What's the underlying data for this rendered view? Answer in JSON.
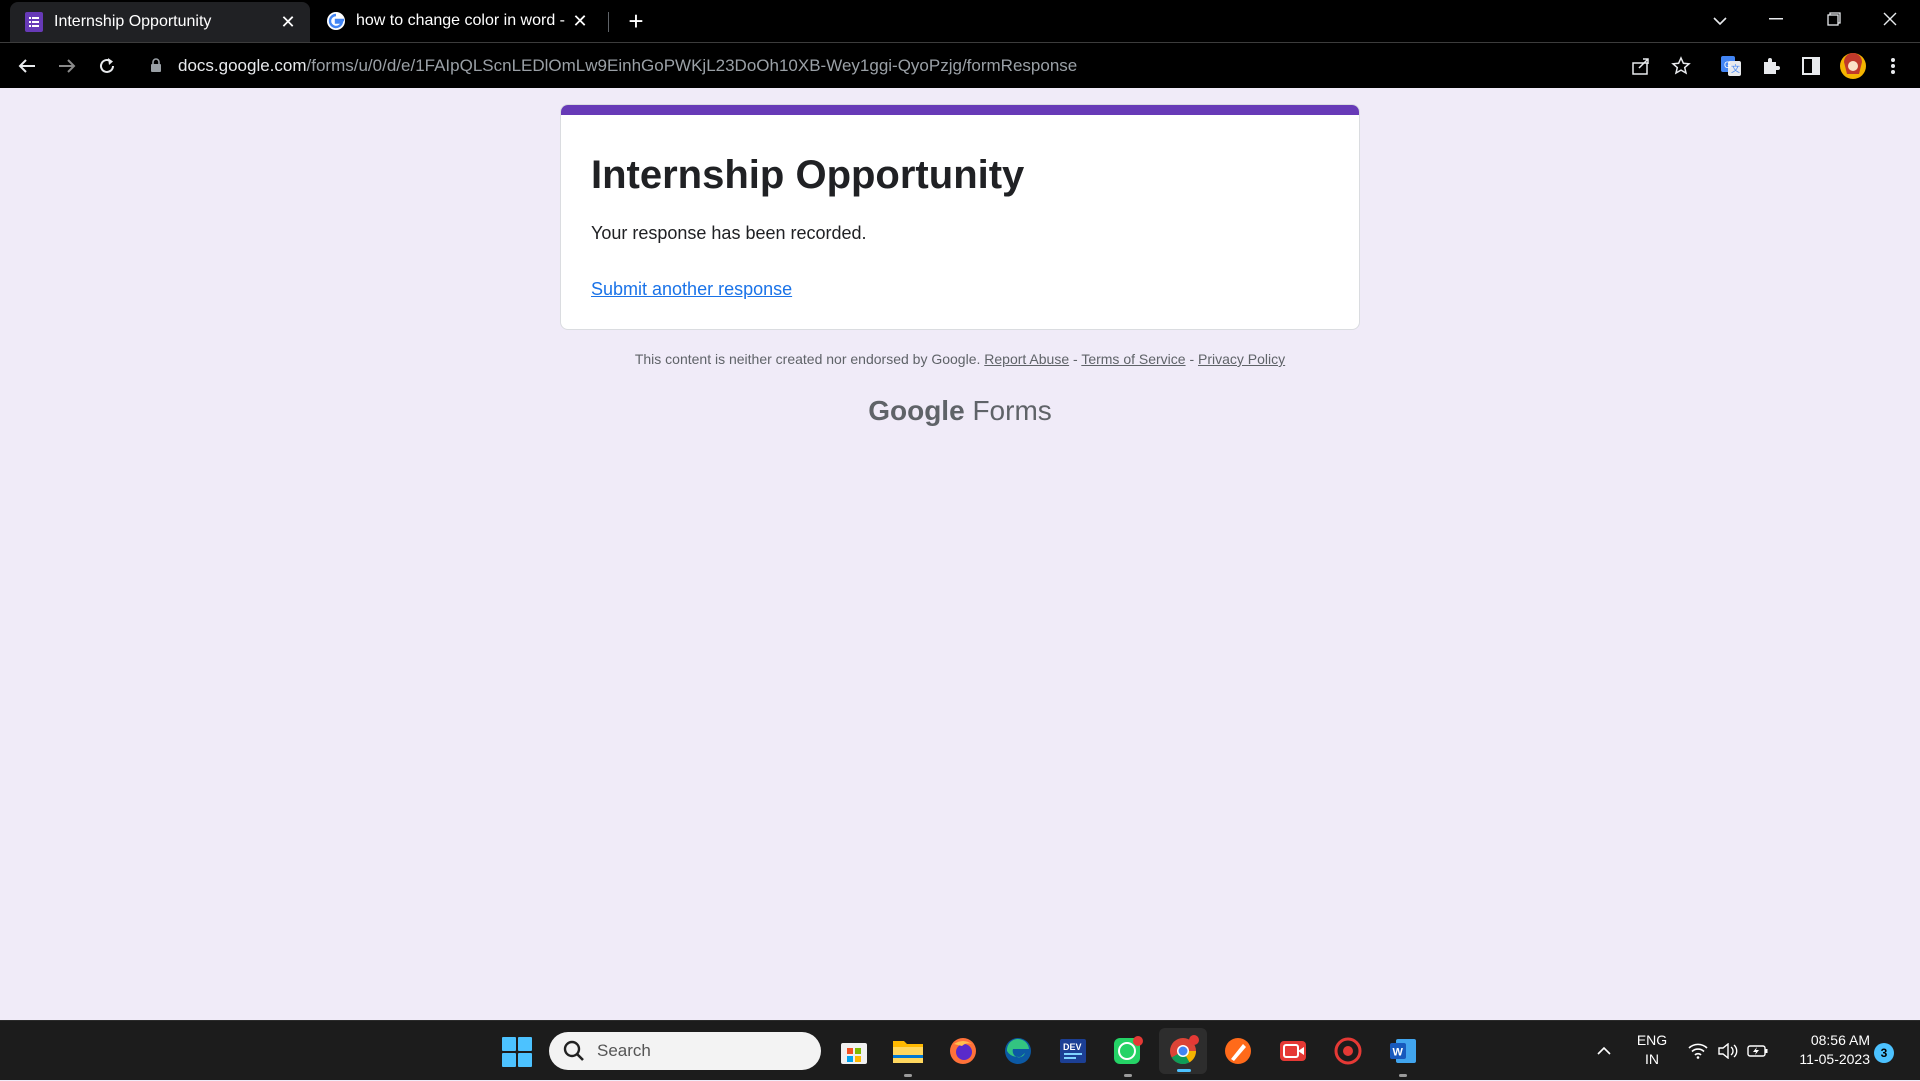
{
  "browser": {
    "tabs": [
      {
        "title": "Internship Opportunity",
        "favicon": "google-forms-icon",
        "active": true
      },
      {
        "title": "how to change color in word - Go",
        "favicon": "google-g-icon",
        "active": false
      }
    ],
    "url_host": "docs.google.com",
    "url_path": "/forms/u/0/d/e/1FAIpQLScnLEDlOmLw9EinhGoPWKjL23DoOh10XB-Wey1ggi-QyoPzjg/formResponse"
  },
  "form": {
    "accent_color": "#673ab7",
    "title": "Internship Opportunity",
    "message": "Your response has been recorded.",
    "submit_another": "Submit another response"
  },
  "footer": {
    "disclaimer": "This content is neither created nor endorsed by Google.",
    "report_abuse": "Report Abuse",
    "sep1": " - ",
    "terms": "Terms of Service",
    "sep2": " - ",
    "privacy": "Privacy Policy",
    "brand_google": "Google",
    "brand_forms": " Forms"
  },
  "taskbar": {
    "search_placeholder": "Search",
    "apps": [
      "store-icon",
      "file-explorer-icon",
      "firefox-icon",
      "edge-icon",
      "dev-home-icon",
      "whatsapp-icon",
      "chrome-icon",
      "paint-icon",
      "screen-recorder-icon",
      "record-icon",
      "word-icon"
    ],
    "lang_line1": "ENG",
    "lang_line2": "IN",
    "time": "08:56 AM",
    "date": "11-05-2023",
    "notification_count": "3"
  }
}
